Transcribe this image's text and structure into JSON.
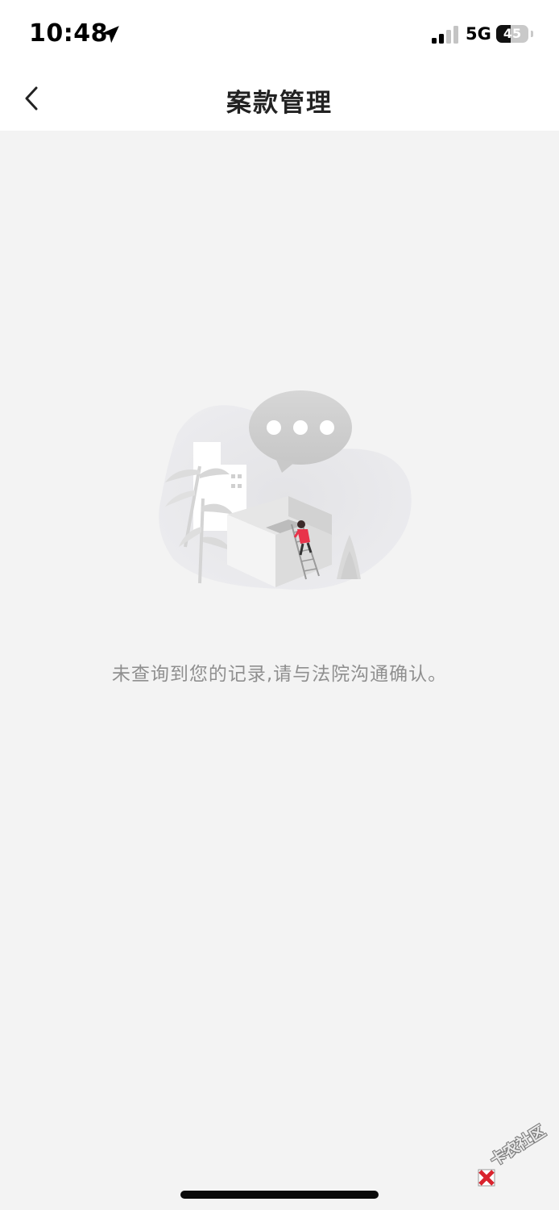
{
  "status_bar": {
    "time": "10:48",
    "network": "5G",
    "battery_level": "45",
    "icons": [
      "location-arrow-icon",
      "signal-icon",
      "battery-icon"
    ]
  },
  "nav": {
    "title": "案款管理",
    "back_icon": "chevron-left-icon"
  },
  "empty_state": {
    "illustration": "empty-records-illustration",
    "message": "未查询到您的记录,请与法院沟通确认。"
  },
  "watermark": {
    "text": "卡农社区"
  },
  "colors": {
    "background": "#f3f3f3",
    "bar": "#ffffff",
    "message": "#8f8f8f",
    "accent_person": "#e8334a"
  }
}
